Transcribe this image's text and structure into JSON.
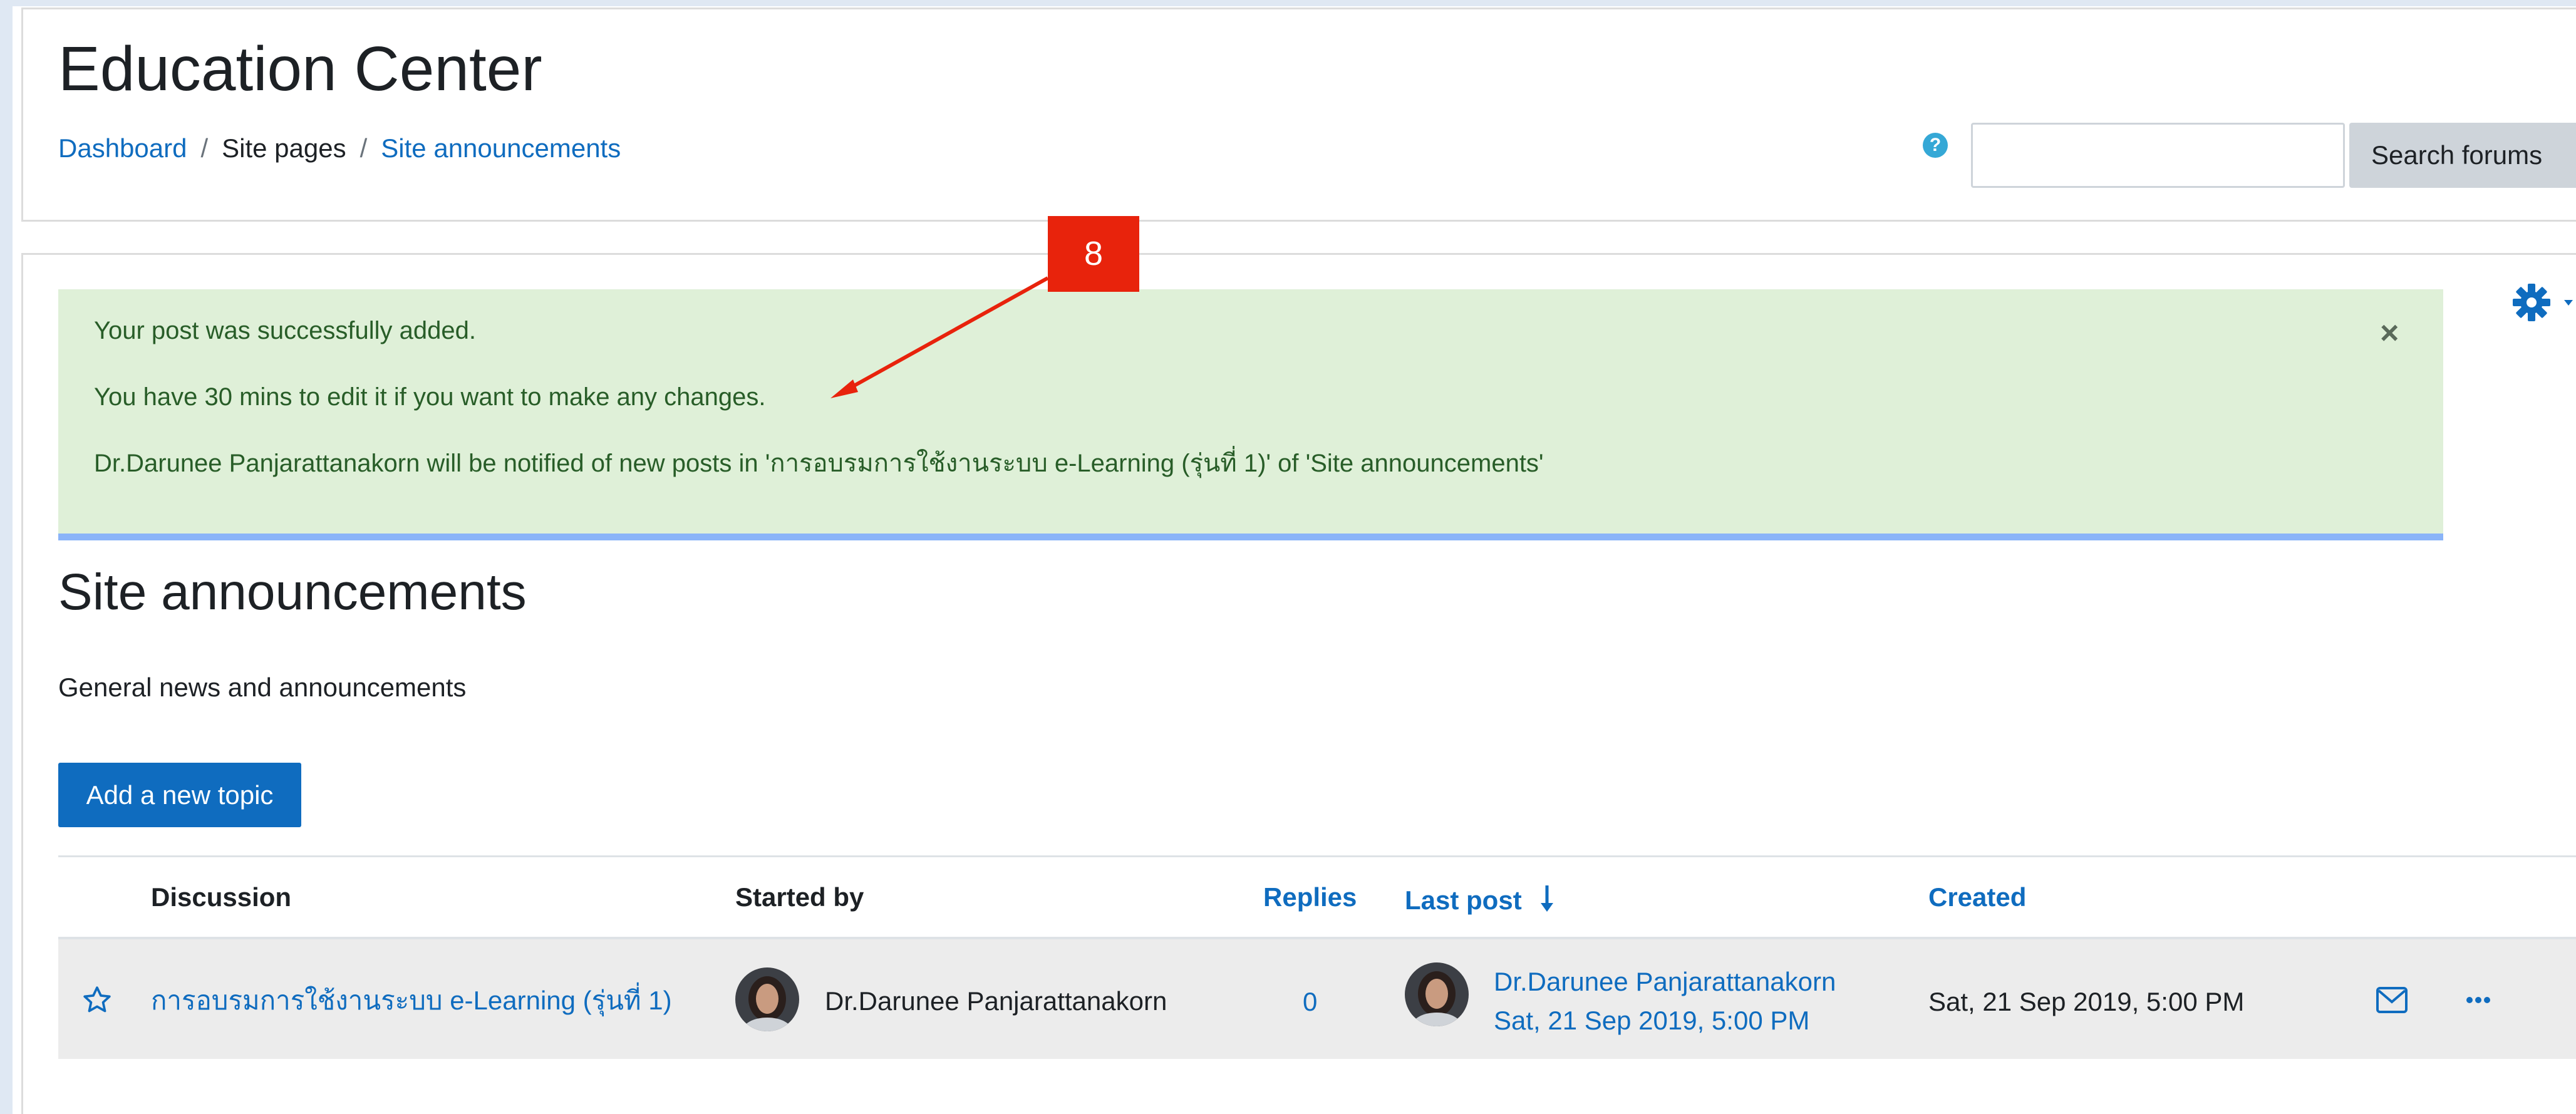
{
  "header": {
    "site_title": "Education Center",
    "breadcrumb": {
      "items": [
        "Dashboard",
        "Site pages",
        "Site announcements"
      ],
      "separator": "/"
    },
    "search": {
      "value": "",
      "button_label": "Search forums",
      "help_icon": "question-circle-icon"
    }
  },
  "alert": {
    "lines": [
      "Your post was successfully added.",
      "You have 30 mins to edit it if you want to make any changes.",
      "Dr.Darunee Panjarattanakorn will be notified of new posts in 'การอบรมการใช้งานระบบ e-Learning (รุ่นที่ 1)' of 'Site announcements'"
    ],
    "close_label": "×",
    "background_color": "#dff0d8"
  },
  "callout": {
    "label": "8",
    "color": "#e8230c"
  },
  "forum": {
    "title": "Site announcements",
    "description": "General news and announcements",
    "add_topic_label": "Add a new topic",
    "settings_icon": "gear-icon"
  },
  "table": {
    "headers": {
      "discussion": "Discussion",
      "started_by": "Started by",
      "replies": "Replies",
      "last_post": "Last post",
      "created": "Created"
    },
    "rows": [
      {
        "discussion": "การอบรมการใช้งานระบบ e-Learning (รุ่นที่ 1)",
        "started_by": "Dr.Darunee Panjarattanakorn",
        "replies": "0",
        "last_post_author": "Dr.Darunee Panjarattanakorn",
        "last_post_date": "Sat, 21 Sep 2019, 5:00 PM",
        "created": "Sat, 21 Sep 2019, 5:00 PM"
      }
    ]
  },
  "colors": {
    "accent": "#0f6cbf",
    "alert_text": "#285d28",
    "row_background": "#ececec"
  }
}
